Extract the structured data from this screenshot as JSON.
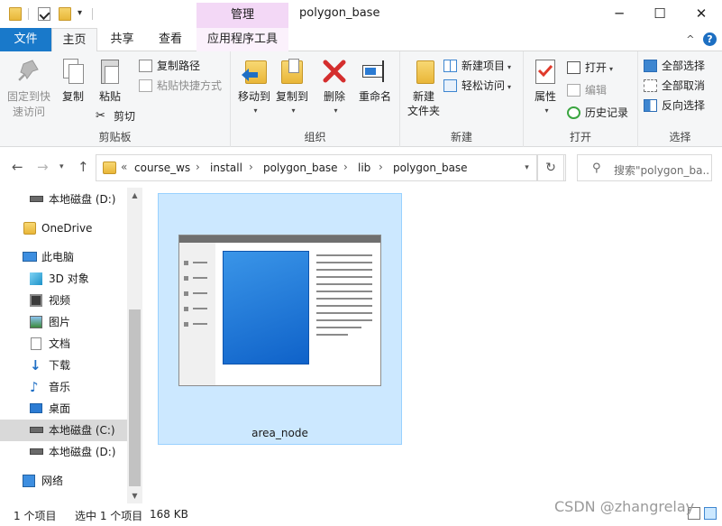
{
  "title_bar": {
    "manage_tab": "管理",
    "window_title": "polygon_base",
    "minimize": "─",
    "maximize": "☐",
    "close": "✕"
  },
  "ribbon_tabs": {
    "file": "文件",
    "home": "主页",
    "share": "共享",
    "view": "查看",
    "app_tools": "应用程序工具",
    "collapse": "^"
  },
  "ribbon": {
    "clipboard": {
      "group_label": "剪贴板",
      "pin_quick_access": "固定到快\n速访问",
      "copy": "复制",
      "paste": "粘贴",
      "copy_path": "复制路径",
      "paste_shortcut": "粘贴快捷方式",
      "cut": "剪切"
    },
    "organize": {
      "group_label": "组织",
      "move_to": "移动到",
      "copy_to": "复制到",
      "delete": "删除",
      "rename": "重命名"
    },
    "new": {
      "group_label": "新建",
      "new_folder": "新建\n文件夹",
      "new_item": "新建项目",
      "easy_access": "轻松访问"
    },
    "open": {
      "group_label": "打开",
      "properties": "属性",
      "open": "打开",
      "edit": "编辑",
      "history": "历史记录"
    },
    "select": {
      "group_label": "选择",
      "select_all": "全部选择",
      "select_none": "全部取消",
      "invert": "反向选择"
    }
  },
  "address": {
    "breadcrumbs": [
      "course_ws",
      "install",
      "polygon_base",
      "lib",
      "polygon_base"
    ],
    "overflow": "«",
    "search_placeholder": "搜索\"polygon_ba..."
  },
  "nav_pane": {
    "items": [
      {
        "label": "本地磁盘 (D:)",
        "icon": "drive-icon"
      },
      {
        "label": "OneDrive",
        "icon": "onedrive-folder-icon"
      },
      {
        "label": "此电脑",
        "icon": "this-pc-icon"
      },
      {
        "label": "3D 对象",
        "icon": "3d-objects-icon"
      },
      {
        "label": "视频",
        "icon": "video-icon"
      },
      {
        "label": "图片",
        "icon": "pictures-icon"
      },
      {
        "label": "文档",
        "icon": "documents-icon"
      },
      {
        "label": "下载",
        "icon": "downloads-icon"
      },
      {
        "label": "音乐",
        "icon": "music-icon"
      },
      {
        "label": "桌面",
        "icon": "desktop-icon"
      },
      {
        "label": "本地磁盘 (C:)",
        "icon": "drive-c-icon",
        "selected": true
      },
      {
        "label": "本地磁盘 (D:)",
        "icon": "drive-icon"
      },
      {
        "label": "网络",
        "icon": "network-icon"
      }
    ]
  },
  "content": {
    "files": [
      {
        "name": "area_node",
        "selected": true
      }
    ]
  },
  "status_bar": {
    "item_count": "1 个项目",
    "selection": "选中 1 个项目",
    "size": "168 KB"
  },
  "watermark": "CSDN @zhangrelay",
  "colors": {
    "file_tab": "#1979ca",
    "manage_tab": "#f3d8f6",
    "selection": "#cce8ff",
    "delete_red": "#d42e2e"
  }
}
